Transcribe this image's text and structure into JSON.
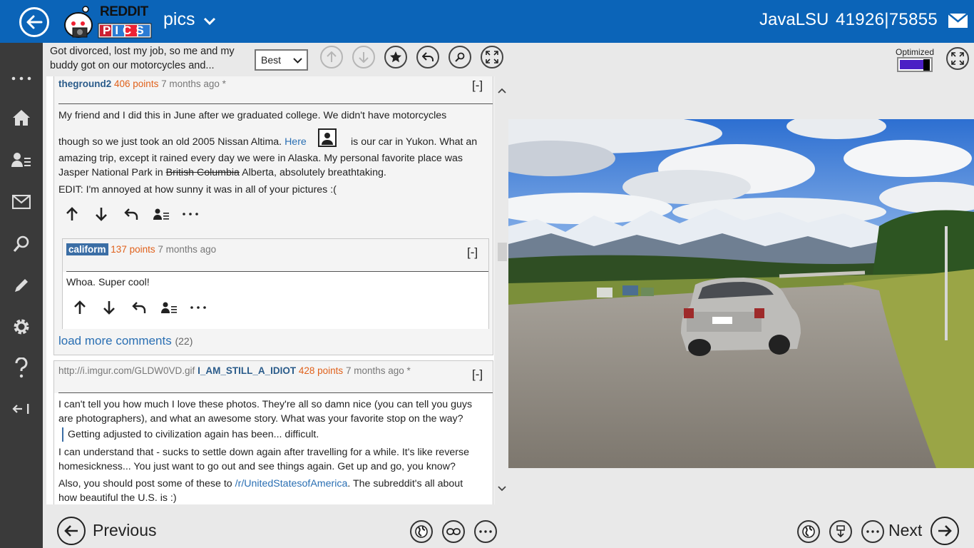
{
  "header": {
    "logo_text_top": "REDDIT",
    "logo_text_bottom": "PICS",
    "subreddit": "pics",
    "username": "JavaLSU",
    "karma": "41926|75855"
  },
  "post": {
    "title": "Got divorced, lost my job, so me and my buddy got on our motorcycles and..."
  },
  "sort": {
    "selected": "Best"
  },
  "comments": [
    {
      "author": "theground2",
      "points": "406 points",
      "ago": "7 months ago *",
      "collapse": "[-]",
      "line1": "My friend and I did this in June after we graduated college. We didn't have motorcycles",
      "line2a": "though so we just took an old 2005 Nissan Altima.",
      "link": "Here",
      "line2b": "is our car in Yukon. What an",
      "line3": "amazing trip, except it rained every day we were in Alaska. My personal favorite place was",
      "line4a": "Jasper National Park in",
      "struck": "British Columbia",
      "line4b": "Alberta, absolutely breathtaking.",
      "line5": "EDIT: I'm annoyed at how sunny it was in all of your pictures :("
    },
    {
      "author": "caliform",
      "points": "137 points",
      "ago": "7 months ago",
      "collapse": "[-]",
      "text": "Whoa. Super cool!"
    },
    {
      "source": "http://i.imgur.com/GLDW0VD.gif",
      "author": "I_AM_STILL_A_IDIOT",
      "points": "428 points",
      "ago": "7 months ago *",
      "collapse": "[-]",
      "p1": "I can't tell you how much I love these photos. They're all so damn nice (you can tell you guys",
      "p1b": "are photographers), and what an awesome story. What was your favorite stop on the way?",
      "quote": "Getting adjusted to civilization again has been... difficult.",
      "p2": "I can understand that - sucks to settle down again after travelling for a while. It's like reverse",
      "p2b": "homesickness... You just want to go out and see things again. Get up and go, you know?",
      "p3a": "Also, you should post some of these to",
      "p3link": "/r/UnitedStatesofAmerica",
      "p3b": ". The subreddit's all about",
      "p3c": "how beautiful the U.S. is :)"
    }
  ],
  "load_more": {
    "label": "load more comments",
    "count": "(22)"
  },
  "viewer": {
    "optimized_label": "Optimized",
    "optimized_level": 0.75
  },
  "bottom": {
    "previous": "Previous",
    "next": "Next"
  },
  "icons": {
    "nav": [
      "more-icon",
      "home-icon",
      "user-list-icon",
      "mail-icon",
      "search-icon",
      "edit-icon",
      "settings-icon",
      "help-icon",
      "collapse-nav-icon"
    ]
  },
  "colors": {
    "topbar": "#0b64b8",
    "nav": "#3a3a3a",
    "author": "#2a5b8a",
    "points": "#e0611b",
    "link": "#2a6fb3",
    "toggle": "#4b1fc5"
  }
}
